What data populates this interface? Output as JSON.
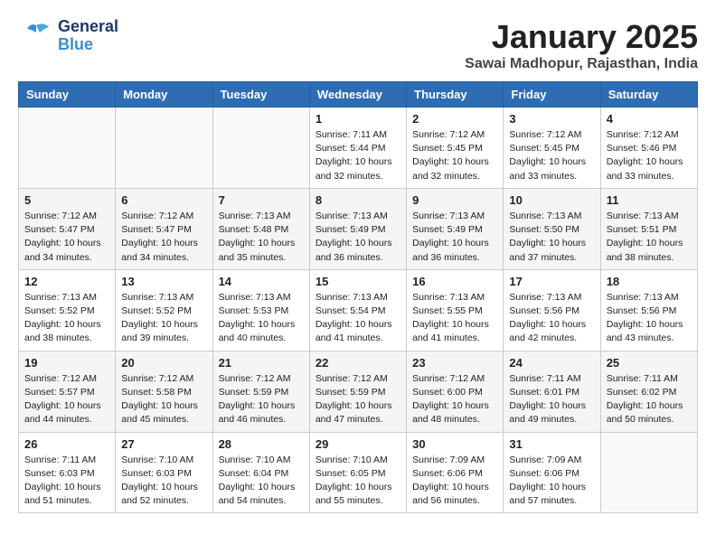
{
  "header": {
    "logo_general": "General",
    "logo_blue": "Blue",
    "main_title": "January 2025",
    "sub_title": "Sawai Madhopur, Rajasthan, India"
  },
  "calendar": {
    "days_of_week": [
      "Sunday",
      "Monday",
      "Tuesday",
      "Wednesday",
      "Thursday",
      "Friday",
      "Saturday"
    ],
    "weeks": [
      [
        {
          "day": "",
          "info": ""
        },
        {
          "day": "",
          "info": ""
        },
        {
          "day": "",
          "info": ""
        },
        {
          "day": "1",
          "info": "Sunrise: 7:11 AM\nSunset: 5:44 PM\nDaylight: 10 hours\nand 32 minutes."
        },
        {
          "day": "2",
          "info": "Sunrise: 7:12 AM\nSunset: 5:45 PM\nDaylight: 10 hours\nand 32 minutes."
        },
        {
          "day": "3",
          "info": "Sunrise: 7:12 AM\nSunset: 5:45 PM\nDaylight: 10 hours\nand 33 minutes."
        },
        {
          "day": "4",
          "info": "Sunrise: 7:12 AM\nSunset: 5:46 PM\nDaylight: 10 hours\nand 33 minutes."
        }
      ],
      [
        {
          "day": "5",
          "info": "Sunrise: 7:12 AM\nSunset: 5:47 PM\nDaylight: 10 hours\nand 34 minutes."
        },
        {
          "day": "6",
          "info": "Sunrise: 7:12 AM\nSunset: 5:47 PM\nDaylight: 10 hours\nand 34 minutes."
        },
        {
          "day": "7",
          "info": "Sunrise: 7:13 AM\nSunset: 5:48 PM\nDaylight: 10 hours\nand 35 minutes."
        },
        {
          "day": "8",
          "info": "Sunrise: 7:13 AM\nSunset: 5:49 PM\nDaylight: 10 hours\nand 36 minutes."
        },
        {
          "day": "9",
          "info": "Sunrise: 7:13 AM\nSunset: 5:49 PM\nDaylight: 10 hours\nand 36 minutes."
        },
        {
          "day": "10",
          "info": "Sunrise: 7:13 AM\nSunset: 5:50 PM\nDaylight: 10 hours\nand 37 minutes."
        },
        {
          "day": "11",
          "info": "Sunrise: 7:13 AM\nSunset: 5:51 PM\nDaylight: 10 hours\nand 38 minutes."
        }
      ],
      [
        {
          "day": "12",
          "info": "Sunrise: 7:13 AM\nSunset: 5:52 PM\nDaylight: 10 hours\nand 38 minutes."
        },
        {
          "day": "13",
          "info": "Sunrise: 7:13 AM\nSunset: 5:52 PM\nDaylight: 10 hours\nand 39 minutes."
        },
        {
          "day": "14",
          "info": "Sunrise: 7:13 AM\nSunset: 5:53 PM\nDaylight: 10 hours\nand 40 minutes."
        },
        {
          "day": "15",
          "info": "Sunrise: 7:13 AM\nSunset: 5:54 PM\nDaylight: 10 hours\nand 41 minutes."
        },
        {
          "day": "16",
          "info": "Sunrise: 7:13 AM\nSunset: 5:55 PM\nDaylight: 10 hours\nand 41 minutes."
        },
        {
          "day": "17",
          "info": "Sunrise: 7:13 AM\nSunset: 5:56 PM\nDaylight: 10 hours\nand 42 minutes."
        },
        {
          "day": "18",
          "info": "Sunrise: 7:13 AM\nSunset: 5:56 PM\nDaylight: 10 hours\nand 43 minutes."
        }
      ],
      [
        {
          "day": "19",
          "info": "Sunrise: 7:12 AM\nSunset: 5:57 PM\nDaylight: 10 hours\nand 44 minutes."
        },
        {
          "day": "20",
          "info": "Sunrise: 7:12 AM\nSunset: 5:58 PM\nDaylight: 10 hours\nand 45 minutes."
        },
        {
          "day": "21",
          "info": "Sunrise: 7:12 AM\nSunset: 5:59 PM\nDaylight: 10 hours\nand 46 minutes."
        },
        {
          "day": "22",
          "info": "Sunrise: 7:12 AM\nSunset: 5:59 PM\nDaylight: 10 hours\nand 47 minutes."
        },
        {
          "day": "23",
          "info": "Sunrise: 7:12 AM\nSunset: 6:00 PM\nDaylight: 10 hours\nand 48 minutes."
        },
        {
          "day": "24",
          "info": "Sunrise: 7:11 AM\nSunset: 6:01 PM\nDaylight: 10 hours\nand 49 minutes."
        },
        {
          "day": "25",
          "info": "Sunrise: 7:11 AM\nSunset: 6:02 PM\nDaylight: 10 hours\nand 50 minutes."
        }
      ],
      [
        {
          "day": "26",
          "info": "Sunrise: 7:11 AM\nSunset: 6:03 PM\nDaylight: 10 hours\nand 51 minutes."
        },
        {
          "day": "27",
          "info": "Sunrise: 7:10 AM\nSunset: 6:03 PM\nDaylight: 10 hours\nand 52 minutes."
        },
        {
          "day": "28",
          "info": "Sunrise: 7:10 AM\nSunset: 6:04 PM\nDaylight: 10 hours\nand 54 minutes."
        },
        {
          "day": "29",
          "info": "Sunrise: 7:10 AM\nSunset: 6:05 PM\nDaylight: 10 hours\nand 55 minutes."
        },
        {
          "day": "30",
          "info": "Sunrise: 7:09 AM\nSunset: 6:06 PM\nDaylight: 10 hours\nand 56 minutes."
        },
        {
          "day": "31",
          "info": "Sunrise: 7:09 AM\nSunset: 6:06 PM\nDaylight: 10 hours\nand 57 minutes."
        },
        {
          "day": "",
          "info": ""
        }
      ]
    ]
  }
}
